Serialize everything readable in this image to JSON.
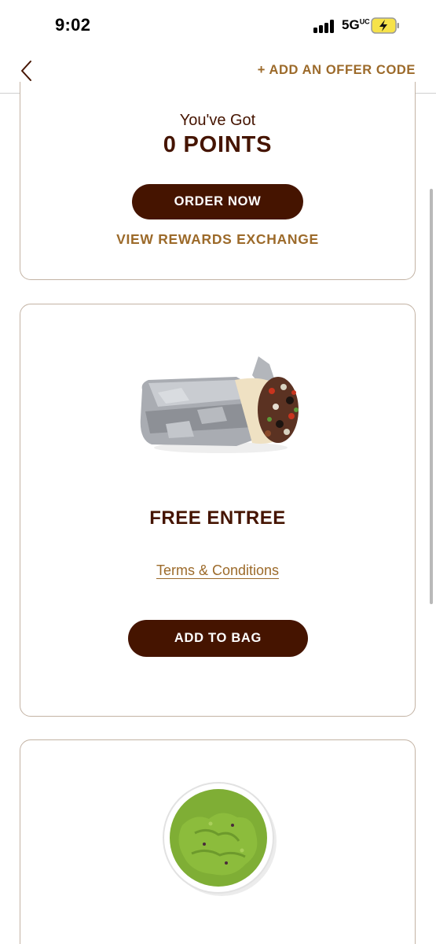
{
  "status_bar": {
    "time": "9:02",
    "network": "5G",
    "network_suffix": "UC"
  },
  "header": {
    "offer_code_link": "+ ADD AN OFFER CODE"
  },
  "points_card": {
    "label": "You've Got",
    "points": "0 POINTS",
    "order_button": "ORDER NOW",
    "rewards_link": "VIEW REWARDS EXCHANGE"
  },
  "reward_cards": [
    {
      "title": "FREE ENTREE",
      "terms_link": "Terms & Conditions",
      "button": "ADD TO BAG",
      "image": "burrito-image"
    },
    {
      "image": "guacamole-image"
    }
  ],
  "colors": {
    "brand_dark": "#451400",
    "accent": "#9c6a2a",
    "card_border": "#c3b3a4"
  },
  "icons": [
    "back-chevron-icon",
    "signal-icon",
    "battery-charging-icon"
  ]
}
